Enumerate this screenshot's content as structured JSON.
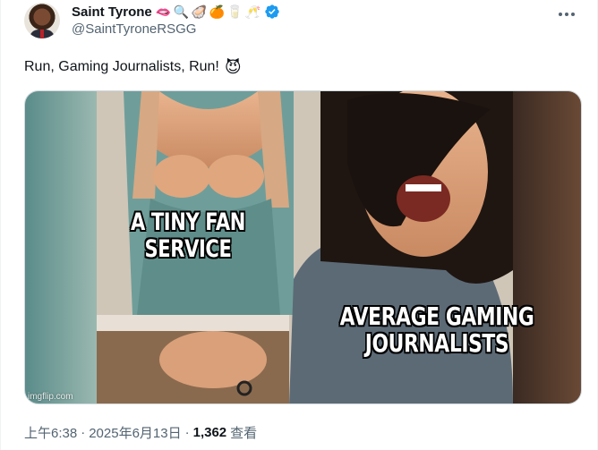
{
  "tweet": {
    "author": {
      "display_name": "Saint Tyrone",
      "name_emojis": [
        "🫦",
        "🔍",
        "🦪",
        "🍊",
        "🥛",
        "🥂"
      ],
      "handle": "@SaintTyroneRSGG",
      "verified": true,
      "verified_color": "#1d9bf0"
    },
    "text": "Run, Gaming Journalists, Run!",
    "text_emoji": "😈",
    "media": {
      "caption_left": "A TINY FAN SERVICE",
      "caption_right": "AVERAGE GAMING JOURNALISTS",
      "watermark": "imgflip.com"
    },
    "meta": {
      "time": "上午6:38",
      "date": "2025年6月13日",
      "separator": "·",
      "views_count": "1,362",
      "views_label": "查看"
    },
    "more_icon": "more-horizontal-icon"
  }
}
